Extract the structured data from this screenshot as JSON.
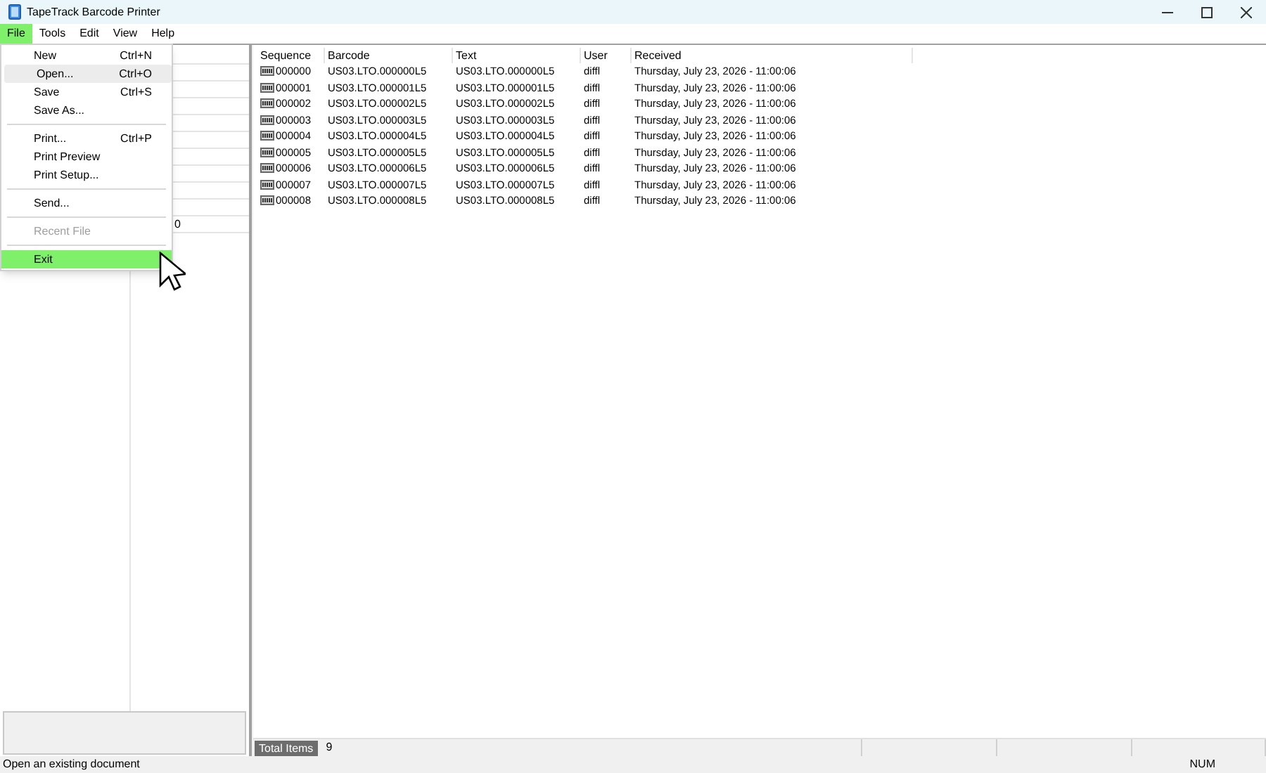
{
  "window": {
    "title": "TapeTrack Barcode Printer"
  },
  "menu_bar": [
    {
      "label": "File",
      "selected": true
    },
    {
      "label": "Tools",
      "selected": false
    },
    {
      "label": "Edit",
      "selected": false
    },
    {
      "label": "View",
      "selected": false
    },
    {
      "label": "Help",
      "selected": false
    }
  ],
  "file_menu": [
    {
      "kind": "item",
      "label": "New",
      "shortcut": "Ctrl+N",
      "disabled": false,
      "hovered": false,
      "selected": false
    },
    {
      "kind": "item",
      "label": "Open...",
      "shortcut": "Ctrl+O",
      "disabled": false,
      "hovered": true,
      "selected": false
    },
    {
      "kind": "item",
      "label": "Save",
      "shortcut": "Ctrl+S",
      "disabled": false,
      "hovered": false,
      "selected": false
    },
    {
      "kind": "item",
      "label": "Save As...",
      "disabled": false,
      "hovered": false,
      "selected": false
    },
    {
      "kind": "separator"
    },
    {
      "kind": "item",
      "label": "Print...",
      "shortcut": "Ctrl+P",
      "disabled": false,
      "hovered": false,
      "selected": false
    },
    {
      "kind": "item",
      "label": "Print Preview",
      "disabled": false,
      "hovered": false,
      "selected": false
    },
    {
      "kind": "item",
      "label": "Print Setup...",
      "disabled": false,
      "hovered": false,
      "selected": false
    },
    {
      "kind": "separator"
    },
    {
      "kind": "item",
      "label": "Send...",
      "disabled": false,
      "hovered": false,
      "selected": false
    },
    {
      "kind": "separator"
    },
    {
      "kind": "item",
      "label": "Recent File",
      "disabled": true,
      "hovered": false,
      "selected": false
    },
    {
      "kind": "separator"
    },
    {
      "kind": "item",
      "label": "Exit",
      "disabled": false,
      "hovered": false,
      "selected": true
    }
  ],
  "left_grid": {
    "rows": [
      [],
      [],
      [],
      [],
      [],
      [],
      [],
      [],
      [],
      [],
      [
        "",
        "0"
      ]
    ]
  },
  "table": {
    "columns": [
      "Sequence",
      "Barcode",
      "Text",
      "User",
      "Received"
    ],
    "rows": [
      [
        "000000",
        "US03.LTO.000000L5",
        "US03.LTO.000000L5",
        "diffl",
        "Thursday, July 23, 2026 - 11:00:06"
      ],
      [
        "000001",
        "US03.LTO.000001L5",
        "US03.LTO.000001L5",
        "diffl",
        "Thursday, July 23, 2026 - 11:00:06"
      ],
      [
        "000002",
        "US03.LTO.000002L5",
        "US03.LTO.000002L5",
        "diffl",
        "Thursday, July 23, 2026 - 11:00:06"
      ],
      [
        "000003",
        "US03.LTO.000003L5",
        "US03.LTO.000003L5",
        "diffl",
        "Thursday, July 23, 2026 - 11:00:06"
      ],
      [
        "000004",
        "US03.LTO.000004L5",
        "US03.LTO.000004L5",
        "diffl",
        "Thursday, July 23, 2026 - 11:00:06"
      ],
      [
        "000005",
        "US03.LTO.000005L5",
        "US03.LTO.000005L5",
        "diffl",
        "Thursday, July 23, 2026 - 11:00:06"
      ],
      [
        "000006",
        "US03.LTO.000006L5",
        "US03.LTO.000006L5",
        "diffl",
        "Thursday, July 23, 2026 - 11:00:06"
      ],
      [
        "000007",
        "US03.LTO.000007L5",
        "US03.LTO.000007L5",
        "diffl",
        "Thursday, July 23, 2026 - 11:00:06"
      ],
      [
        "000008",
        "US03.LTO.000008L5",
        "US03.LTO.000008L5",
        "diffl",
        "Thursday, July 23, 2026 - 11:00:06"
      ]
    ]
  },
  "totals": {
    "label": "Total Items",
    "value": "9"
  },
  "status_bar": {
    "message": "Open an existing document",
    "indicator": "NUM"
  }
}
